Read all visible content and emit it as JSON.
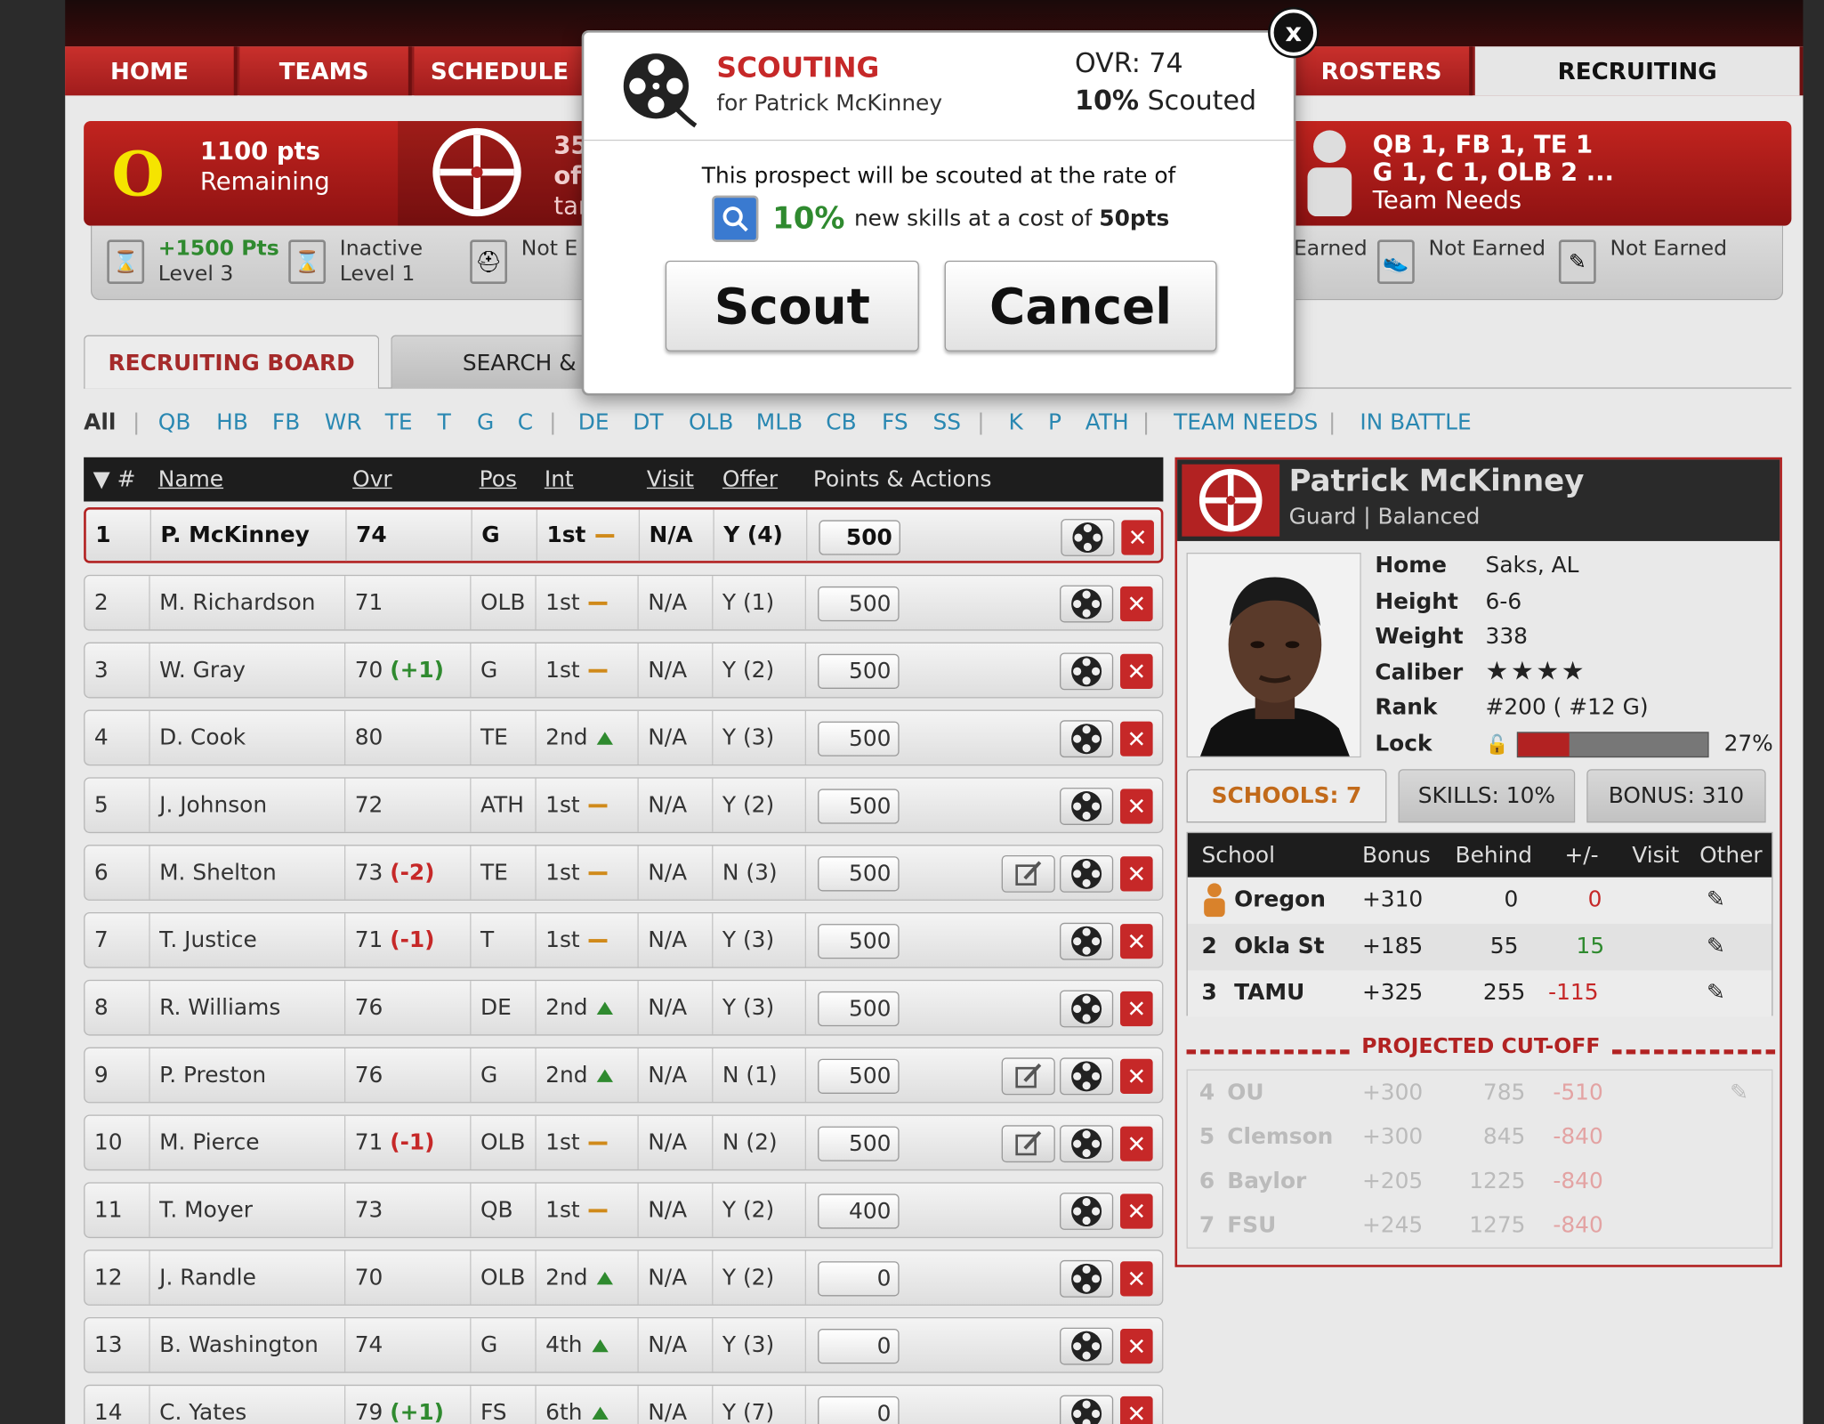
{
  "nav": {
    "tabs": [
      "HOME",
      "TEAMS",
      "SCHEDULE",
      "ROSTERS",
      "RECRUITING"
    ]
  },
  "banner": {
    "logo_letter": "O",
    "points": "1100 pts",
    "remaining": "Remaining",
    "middle_lines": [
      "35",
      "of",
      "tar"
    ],
    "needs_line1": "QB 1, FB 1, TE 1",
    "needs_line2": "G 1, C 1, OLB 2 ...",
    "needs_label": "Team Needs"
  },
  "levels": [
    {
      "line1": "+1500 Pts",
      "line2": "Level 3"
    },
    {
      "line1": "Inactive",
      "line2": "Level 1"
    },
    {
      "line1": "Not E",
      "line2": ""
    },
    {
      "line1": "Earned",
      "line2": ""
    },
    {
      "line1": "Not Earned",
      "line2": ""
    },
    {
      "line1": "Not Earned",
      "line2": ""
    }
  ],
  "board_tabs": {
    "active": "RECRUITING BOARD",
    "other": "SEARCH & A"
  },
  "filters": [
    "All",
    "QB",
    "HB",
    "FB",
    "WR",
    "TE",
    "T",
    "G",
    "C",
    "DE",
    "DT",
    "OLB",
    "MLB",
    "CB",
    "FS",
    "SS",
    "K",
    "P",
    "ATH",
    "TEAM NEEDS",
    "IN BATTLE"
  ],
  "table": {
    "headers": {
      "num": "▼ #",
      "name": "Name",
      "ovr": "Ovr",
      "pos": "Pos",
      "int": "Int",
      "visit": "Visit",
      "offer": "Offer",
      "actions": "Points & Actions"
    },
    "rows": [
      {
        "n": "1",
        "name": "P. McKinney",
        "ovr": "74",
        "ch": "",
        "pos": "G",
        "int": "1st",
        "trend": "flat",
        "visit": "N/A",
        "offer": "Y (4)",
        "pts": "500",
        "note": false
      },
      {
        "n": "2",
        "name": "M. Richardson",
        "ovr": "71",
        "ch": "",
        "pos": "OLB",
        "int": "1st",
        "trend": "flat",
        "visit": "N/A",
        "offer": "Y (1)",
        "pts": "500",
        "note": false
      },
      {
        "n": "3",
        "name": "W. Gray",
        "ovr": "70",
        "ch": "(+1)",
        "pos": "G",
        "int": "1st",
        "trend": "flat",
        "visit": "N/A",
        "offer": "Y (2)",
        "pts": "500",
        "note": false
      },
      {
        "n": "4",
        "name": "D. Cook",
        "ovr": "80",
        "ch": "",
        "pos": "TE",
        "int": "2nd",
        "trend": "up",
        "visit": "N/A",
        "offer": "Y (3)",
        "pts": "500",
        "note": false
      },
      {
        "n": "5",
        "name": "J. Johnson",
        "ovr": "72",
        "ch": "",
        "pos": "ATH",
        "int": "1st",
        "trend": "flat",
        "visit": "N/A",
        "offer": "Y (2)",
        "pts": "500",
        "note": false
      },
      {
        "n": "6",
        "name": "M. Shelton",
        "ovr": "73",
        "ch": "(-2)",
        "pos": "TE",
        "int": "1st",
        "trend": "flat",
        "visit": "N/A",
        "offer": "N (3)",
        "pts": "500",
        "note": true
      },
      {
        "n": "7",
        "name": "T. Justice",
        "ovr": "71",
        "ch": "(-1)",
        "pos": "T",
        "int": "1st",
        "trend": "flat",
        "visit": "N/A",
        "offer": "Y (3)",
        "pts": "500",
        "note": false
      },
      {
        "n": "8",
        "name": "R. Williams",
        "ovr": "76",
        "ch": "",
        "pos": "DE",
        "int": "2nd",
        "trend": "up",
        "visit": "N/A",
        "offer": "Y (3)",
        "pts": "500",
        "note": false
      },
      {
        "n": "9",
        "name": "P. Preston",
        "ovr": "76",
        "ch": "",
        "pos": "G",
        "int": "2nd",
        "trend": "up",
        "visit": "N/A",
        "offer": "N (1)",
        "pts": "500",
        "note": true
      },
      {
        "n": "10",
        "name": "M. Pierce",
        "ovr": "71",
        "ch": "(-1)",
        "pos": "OLB",
        "int": "1st",
        "trend": "flat",
        "visit": "N/A",
        "offer": "N (2)",
        "pts": "500",
        "note": true
      },
      {
        "n": "11",
        "name": "T. Moyer",
        "ovr": "73",
        "ch": "",
        "pos": "QB",
        "int": "1st",
        "trend": "flat",
        "visit": "N/A",
        "offer": "Y (2)",
        "pts": "400",
        "note": false
      },
      {
        "n": "12",
        "name": "J. Randle",
        "ovr": "70",
        "ch": "",
        "pos": "OLB",
        "int": "2nd",
        "trend": "up",
        "visit": "N/A",
        "offer": "Y (2)",
        "pts": "0",
        "note": false
      },
      {
        "n": "13",
        "name": "B. Washington",
        "ovr": "74",
        "ch": "",
        "pos": "G",
        "int": "4th",
        "trend": "up",
        "visit": "N/A",
        "offer": "Y (3)",
        "pts": "0",
        "note": false
      },
      {
        "n": "14",
        "name": "C. Yates",
        "ovr": "79",
        "ch": "(+1)",
        "pos": "FS",
        "int": "6th",
        "trend": "up",
        "visit": "N/A",
        "offer": "Y (7)",
        "pts": "0",
        "note": false
      }
    ]
  },
  "player": {
    "name": "Patrick McKinney",
    "position": "Guard | Balanced",
    "info": [
      {
        "label": "Home",
        "value": "Saks, AL"
      },
      {
        "label": "Height",
        "value": "6-6"
      },
      {
        "label": "Weight",
        "value": "338"
      },
      {
        "label": "Caliber",
        "value": "★★★★"
      },
      {
        "label": "Rank",
        "value": "#200 ( #12 G)"
      },
      {
        "label": "Lock",
        "value": ""
      }
    ],
    "lock_pct": "27%",
    "lock_fraction": 0.27,
    "tabs": [
      "SCHOOLS: 7",
      "SKILLS: 10%",
      "BONUS: 310"
    ],
    "school_headers": {
      "school": "School",
      "bonus": "Bonus",
      "behind": "Behind",
      "pm": "+/-",
      "visit": "Visit",
      "other": "Other"
    },
    "schools": [
      {
        "rank": "",
        "name": "Oregon",
        "bonus": "+310",
        "behind": "0",
        "pm": "0"
      },
      {
        "rank": "2",
        "name": "Okla St",
        "bonus": "+185",
        "behind": "55",
        "pm": "15"
      },
      {
        "rank": "3",
        "name": "TAMU",
        "bonus": "+325",
        "behind": "255",
        "pm": "-115"
      }
    ],
    "cutoff_label": "PROJECTED CUT-OFF",
    "below": [
      {
        "rank": "4",
        "name": "OU",
        "bonus": "+300",
        "behind": "785",
        "pm": "-510"
      },
      {
        "rank": "5",
        "name": "Clemson",
        "bonus": "+300",
        "behind": "845",
        "pm": "-840"
      },
      {
        "rank": "6",
        "name": "Baylor",
        "bonus": "+205",
        "behind": "1225",
        "pm": "-840"
      },
      {
        "rank": "7",
        "name": "FSU",
        "bonus": "+245",
        "behind": "1275",
        "pm": "-840"
      }
    ]
  },
  "dialog": {
    "close": "x",
    "title": "SCOUTING",
    "for": "for Patrick McKinney",
    "ovr": "OVR: 74",
    "scouted_pct": "10%",
    "scouted_label": "Scouted",
    "message": "This prospect will be scouted at the rate of",
    "rate_pct": "10%",
    "rate_text_a": "new skills at a cost of",
    "rate_cost": "50pts",
    "scout_btn": "Scout",
    "cancel_btn": "Cancel"
  }
}
